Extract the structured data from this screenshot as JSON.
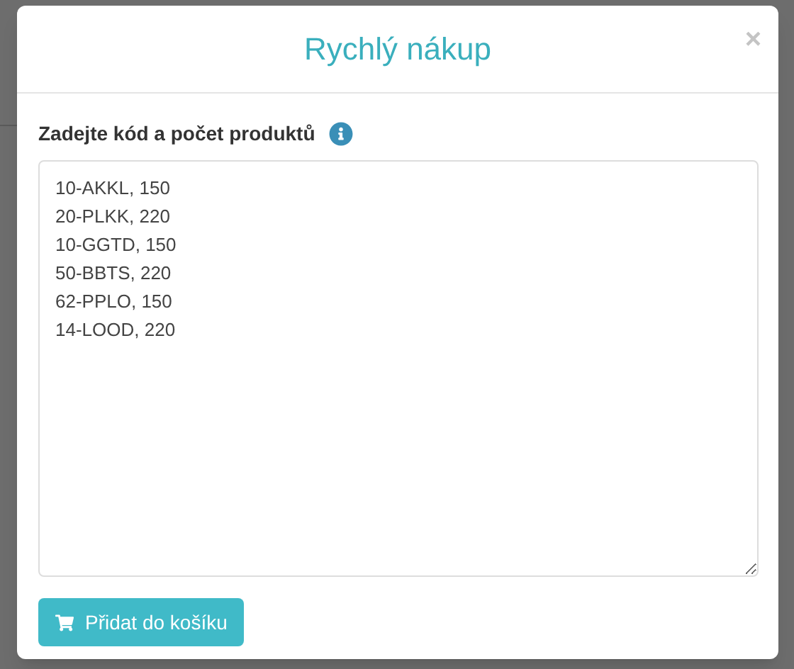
{
  "dialog": {
    "title": "Rychlý nákup",
    "close": "×",
    "field": {
      "label": "Zadejte kód a počet produktů",
      "value": "10-AKKL, 150\n20-PLKK, 220\n10-GGTD, 150\n50-BBTS, 220\n62-PPLO, 150\n14-LOOD, 220"
    },
    "button": "Přidat do košíku"
  }
}
